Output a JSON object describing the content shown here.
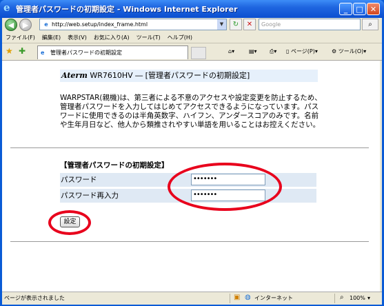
{
  "window": {
    "title": "管理者パスワードの初期設定 - Windows Internet Explorer",
    "minimize": "_",
    "maximize": "□",
    "close": "✕"
  },
  "address_bar": {
    "url": "http://web.setup/index_frame.html",
    "search_placeholder": "Google"
  },
  "menu": [
    "ファイル(F)",
    "編集(E)",
    "表示(V)",
    "お気に入り(A)",
    "ツール(T)",
    "ヘルプ(H)"
  ],
  "tab": {
    "label": "管理者パスワードの初期設定"
  },
  "command_bar": {
    "page_label": "ページ(P)",
    "tools_label": "ツール(O)"
  },
  "page": {
    "brand": "Aterm",
    "model": "WR7610HV",
    "title": "― [管理者パスワードの初期設定]",
    "description": "WARPSTAR(親機)は、第三者による不意のアクセスや設定変更を防止するため、管理者パスワードを入力してはじめてアクセスできるようになっています。パスワードに使用できるのは半角英数字、ハイフン、アンダースコアのみです。名前や生年月日など、他人から類推されやすい単語を用いることはお控えください。",
    "section_title": "【管理者パスワードの初期設定】",
    "password_label": "パスワード",
    "password_value": "•••••••",
    "password_confirm_label": "パスワード再入力",
    "password_confirm_value": "•••••••",
    "submit_label": "設定"
  },
  "status": {
    "text": "ページが表示されました",
    "zone": "インターネット",
    "zoom": "100%"
  },
  "colors": {
    "annotation": "#e8001c",
    "titlebar": "#1f66e0",
    "row_bg": "#dfe9f4"
  }
}
